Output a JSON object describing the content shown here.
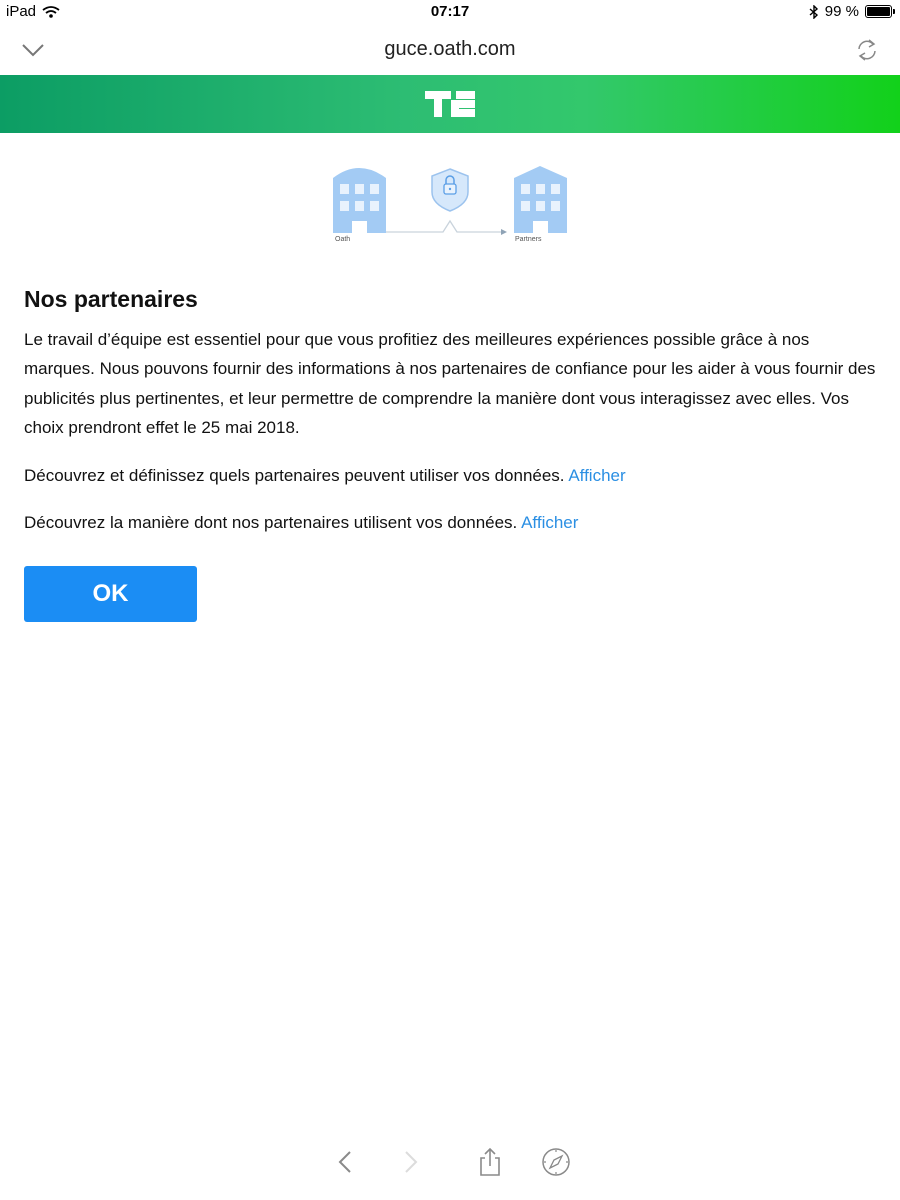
{
  "status_bar": {
    "device": "iPad",
    "time": "07:17",
    "battery": "99 %",
    "battery_level": 0.99
  },
  "browser": {
    "url": "guce.oath.com"
  },
  "banner": {
    "logo": "TC"
  },
  "illustration": {
    "left_label": "Oath",
    "right_label": "Partners"
  },
  "main": {
    "title": "Nos partenaires",
    "paragraph": "Le travail d’équipe est essentiel pour que vous profitiez des meilleures expériences possible grâce à nos marques. Nous pouvons fournir des informations à nos partenaires de confiance pour les aider à vous fournir des publicités plus pertinentes, et leur permettre de comprendre la manière dont vous interagissez avec elles. Vos choix prendront effet le 25 mai 2018.",
    "line1_text": "Découvrez et définissez quels partenaires peuvent utiliser vos données.",
    "line1_link": "Afficher",
    "line2_text": "Découvrez la manière dont nos partenaires utilisent vos données.",
    "line2_link": "Afficher",
    "ok_label": "OK"
  },
  "colors": {
    "accent": "#1b8df4",
    "link": "#2b8fe3",
    "banner_start": "#0c9d64",
    "banner_end": "#12d11a"
  },
  "toolbar": {
    "icons": [
      "back-icon",
      "forward-icon",
      "share-icon",
      "compass-icon"
    ]
  }
}
